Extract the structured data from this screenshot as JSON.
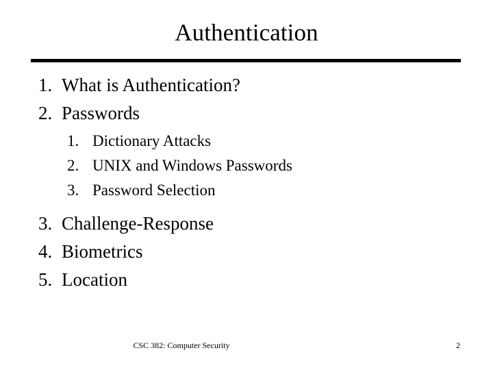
{
  "slide": {
    "title": "Authentication",
    "outline": [
      {
        "number": "1.",
        "text": "What is Authentication?",
        "children": []
      },
      {
        "number": "2.",
        "text": "Passwords",
        "children": [
          {
            "number": "1.",
            "text": "Dictionary Attacks"
          },
          {
            "number": "2.",
            "text": "UNIX and Windows Passwords"
          },
          {
            "number": "3.",
            "text": "Password Selection"
          }
        ]
      },
      {
        "number": "3.",
        "text": "Challenge-Response",
        "children": []
      },
      {
        "number": "4.",
        "text": "Biometrics",
        "children": []
      },
      {
        "number": "5.",
        "text": "Location",
        "children": []
      }
    ],
    "footer": {
      "course": "CSC 382: Computer Security",
      "page_number": "2"
    },
    "colors": {
      "text": "#000000",
      "background": "#ffffff",
      "rule": "#000000"
    }
  }
}
